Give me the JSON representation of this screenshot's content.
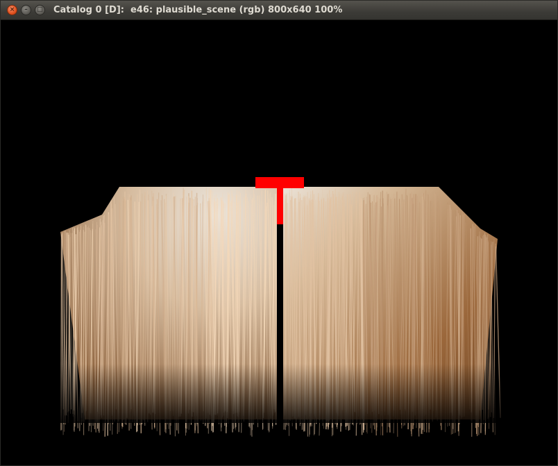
{
  "window": {
    "title": "Catalog 0 [D]:  e46: plausible_scene (rgb) 800x640 100%",
    "buttons": {
      "close": "×",
      "minimize": "–",
      "maximize": "□"
    }
  },
  "viewport": {
    "background": "#000000",
    "render": {
      "subject": "hair-strands-block",
      "strand_light_color": "#fff6e8",
      "strand_mid_color": "#d8ae84",
      "strand_dark_color": "#7a4e2a",
      "marker_color": "#ff0000"
    }
  }
}
